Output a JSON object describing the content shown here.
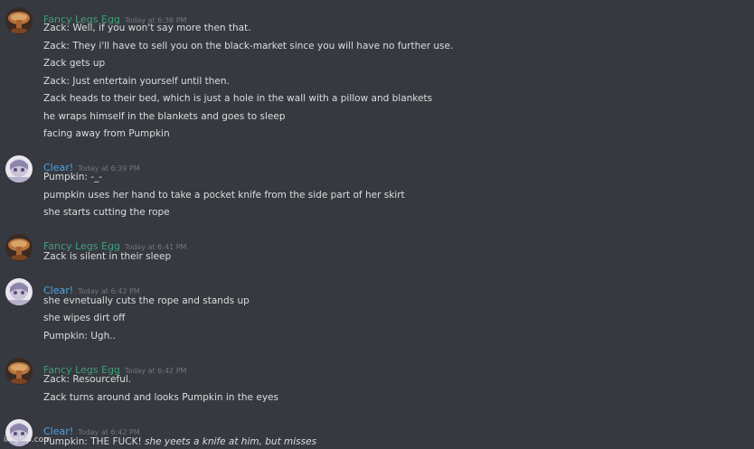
{
  "messages": [
    {
      "author": "Fancy Legs Egg",
      "timestamp": "Today at 6:36 PM",
      "lines": [
        {
          "text": "Zack: Well, if you won't say more then that.",
          "italic": false
        },
        {
          "text": "Zack: They i'll have to sell you on the black-market since you will have no further use.",
          "italic": false
        },
        {
          "text": "Zack gets up",
          "italic": true
        },
        {
          "text": "Zack: Just entertain yourself until then.",
          "italic": false
        },
        {
          "text": "Zack heads to their bed, which is just a hole in the wall with a pillow and blankets",
          "italic": true
        },
        {
          "text": "he wraps himself in the blankets and goes to sleep",
          "italic": true
        },
        {
          "text": "facing away from Pumpkin",
          "italic": true
        }
      ]
    },
    {
      "author": "Clear!",
      "timestamp": "Today at 6:39 PM",
      "lines": [
        {
          "text": "Pumpkin: -_-",
          "italic": false
        },
        {
          "text": "pumpkin uses her hand to take a pocket knife from the side part of her skirt",
          "italic": true
        },
        {
          "text": "she starts cutting the rope",
          "italic": true
        }
      ]
    },
    {
      "author": "Fancy Legs Egg",
      "timestamp": "Today at 6:41 PM",
      "lines": [
        {
          "text": "Zack is silent in their sleep",
          "italic": true
        }
      ]
    },
    {
      "author": "Clear!",
      "timestamp": "Today at 6:42 PM",
      "lines": [
        {
          "text": "she evnetually cuts the rope and stands up",
          "italic": true
        },
        {
          "text": "she wipes dirt off",
          "italic": true
        },
        {
          "text": "Pumpkin: Ugh..",
          "italic": false
        }
      ]
    },
    {
      "author": "Fancy Legs Egg",
      "timestamp": "Today at 6:42 PM",
      "lines": [
        {
          "text": "Zack: Resourceful.",
          "italic": false
        },
        {
          "text": "Zack turns around and looks Pumpkin in the eyes",
          "italic": true
        }
      ]
    },
    {
      "author": "Clear!",
      "timestamp": "Today at 6:42 PM",
      "lines": [
        {
          "text": "Pumpkin: THE FUCK!",
          "italic": false,
          "tail": "she yeets a knife at him, but misses"
        }
      ]
    }
  ],
  "watermark": "imgflip.com",
  "colors": {
    "background": "#36393f",
    "fancy_author": "#3f9f7c",
    "clear_author": "#4ea5e0",
    "timestamp": "#72767d",
    "text": "#dcddde"
  },
  "icons": {
    "fancy_avatar": "egg-avatar-icon",
    "clear_avatar": "anime-girl-avatar-icon"
  }
}
